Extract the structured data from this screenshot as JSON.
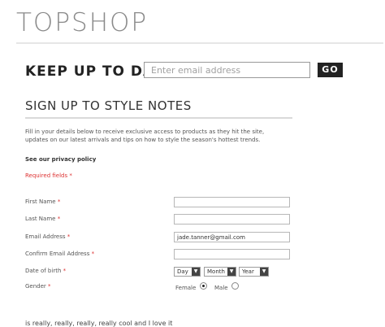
{
  "brand": {
    "logo_text": "TOPSHOP"
  },
  "newsletter_bar": {
    "title": "KEEP UP TO DATE:",
    "email_placeholder": "Enter email address",
    "go_label": "GO"
  },
  "signup": {
    "title": "SIGN UP TO STYLE NOTES",
    "intro_line1": "Fill in your details below to receive exclusive access to products as they hit the site,",
    "intro_line2": "updates on our latest arrivals and tips on how to style the season's hottest trends.",
    "privacy_link": "See our privacy policy",
    "required_note": "Required fields *"
  },
  "form": {
    "first_name": {
      "label": "First Name",
      "value": ""
    },
    "last_name": {
      "label": "Last Name",
      "value": ""
    },
    "email": {
      "label": "Email Address",
      "value": "jade.tanner@gmail.com"
    },
    "confirm_email": {
      "label": "Confirm Email Address",
      "value": ""
    },
    "dob": {
      "label": "Date of birth",
      "day": "Day",
      "month": "Month",
      "year": "Year"
    },
    "gender": {
      "label": "Gender",
      "female": "Female",
      "male": "Male",
      "selected": "Female"
    },
    "required_marker": "*"
  },
  "footer_text": "is really, really, really, really cool and I love it",
  "colors": {
    "required": "#dd3333",
    "button": "#222222",
    "logo": "#8a8a8a"
  }
}
